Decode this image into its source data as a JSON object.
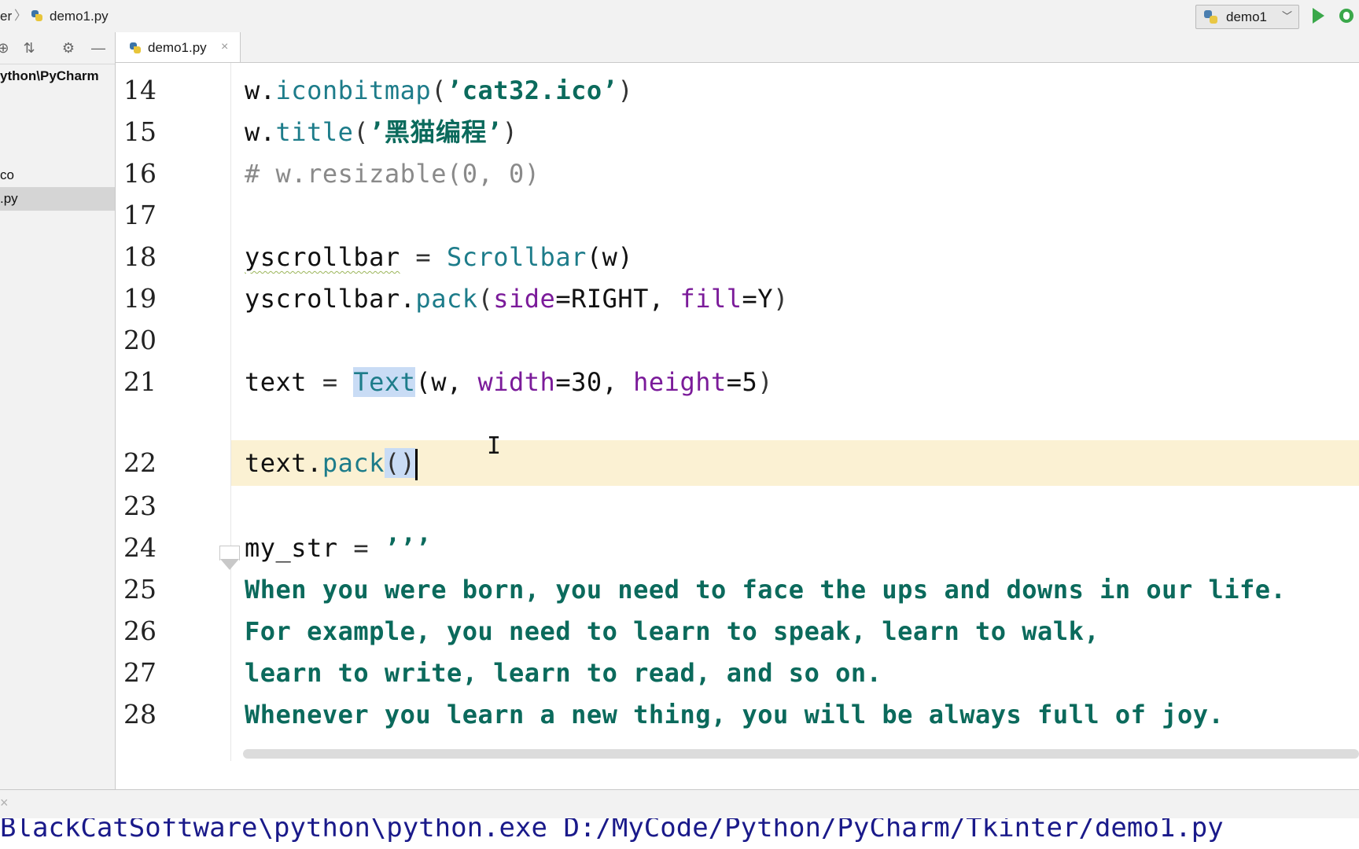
{
  "breadcrumb": {
    "parent": "er",
    "file": "demo1.py"
  },
  "run_config": {
    "label": "demo1"
  },
  "project_panel": {
    "root": "ython\\PyCharm",
    "items": [
      "co",
      ".py"
    ]
  },
  "editor_tab": {
    "label": "demo1.py",
    "close": "×"
  },
  "editor": {
    "line_numbers": [
      "14",
      "15",
      "16",
      "17",
      "18",
      "19",
      "20",
      "21",
      "22",
      "23",
      "24",
      "25",
      "26",
      "27",
      "28"
    ],
    "lines": {
      "l14": {
        "obj": "w.",
        "fn": "iconbitmap",
        "open": "(",
        "str": "’cat32.ico’",
        "close": ")"
      },
      "l15": {
        "obj": "w.",
        "fn": "title",
        "open": "(",
        "str": "’黑猫编程’",
        "close": ")"
      },
      "l16": {
        "comment": "# w.resizable(0, 0)"
      },
      "l18": {
        "var": "yscrollbar",
        "eq": " = ",
        "cls": "Scrollbar",
        "args": "(w)"
      },
      "l19": {
        "var": "yscrollbar.",
        "fn": "pack",
        "open": "(",
        "k1": "side",
        "v1": "=RIGHT, ",
        "k2": "fill",
        "v2": "=Y",
        "close": ")"
      },
      "l21": {
        "var": "text",
        "eq": " = ",
        "cls": "Text",
        "a0": "(w, ",
        "k1": "width",
        "v1": "=30, ",
        "k2": "height",
        "v2": "=5",
        "close": ")"
      },
      "l22": {
        "var": "text.",
        "fn": "pack",
        "parens": "()"
      },
      "l24": {
        "var": "my_str",
        "eq": " = ",
        "str": "’’’"
      },
      "l25": {
        "str": "When you were born, you need to face the ups and downs in our life."
      },
      "l26": {
        "str": "For example, you need to learn to speak, learn to walk,"
      },
      "l27": {
        "str": "learn to write, learn to read, and so on."
      },
      "l28": {
        "str": "Whenever you learn a new thing, you will be always full of joy."
      }
    }
  },
  "console": {
    "command": "BlackCatSoftware\\python\\python.exe D:/MyCode/Python/PyCharm/Tkinter/demo1.py"
  },
  "icons": [
    "python-file-icon",
    "chevron-down-icon",
    "run-icon",
    "debug-icon",
    "locate-icon",
    "collapse-icon",
    "gear-icon",
    "minimize-icon",
    "close-icon",
    "fold-icon",
    "text-cursor-icon"
  ]
}
